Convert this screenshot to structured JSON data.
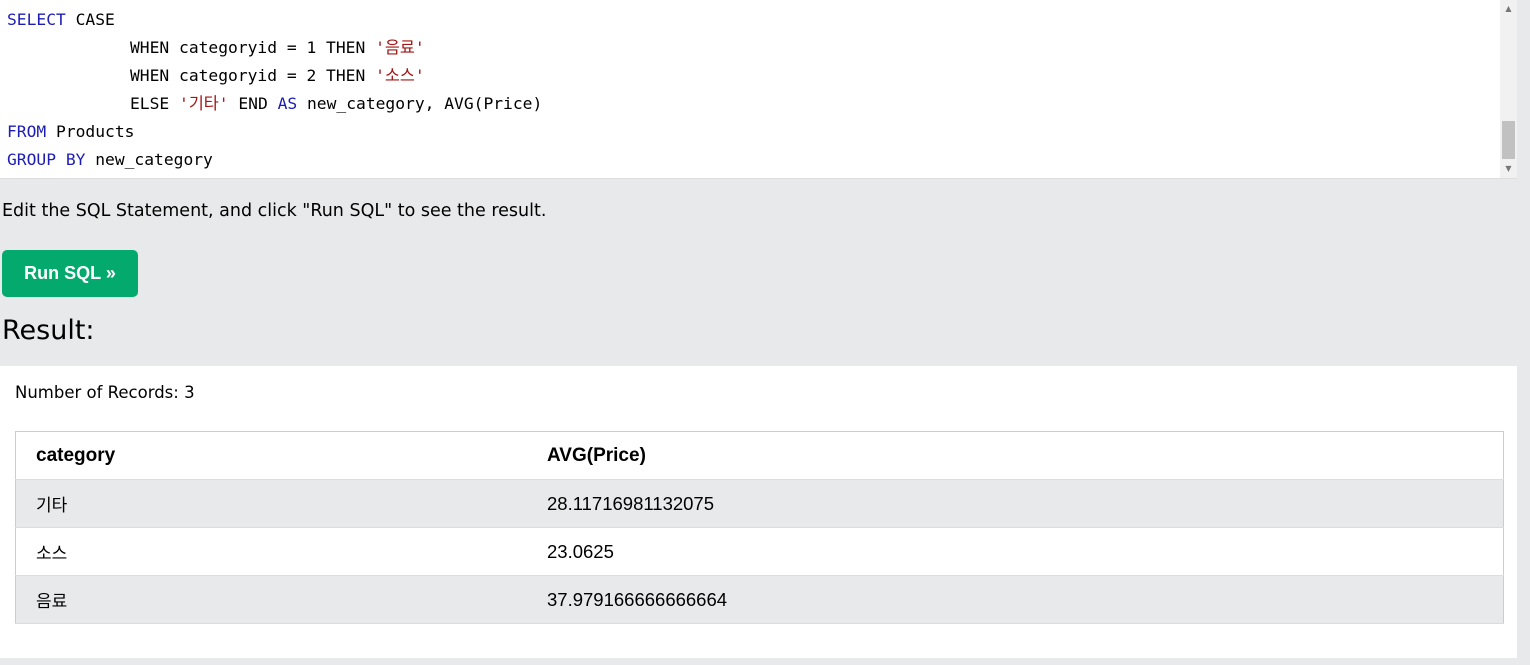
{
  "editor": {
    "lines": [
      {
        "parts": [
          {
            "t": "SELECT",
            "c": "kw"
          },
          {
            "t": " CASE",
            "c": ""
          }
        ]
      },
      {
        "indent": true,
        "parts": [
          {
            "t": "WHEN categoryid = 1 THEN ",
            "c": ""
          },
          {
            "t": "'음료'",
            "c": "str"
          }
        ]
      },
      {
        "indent": true,
        "parts": [
          {
            "t": "WHEN categoryid = 2 THEN ",
            "c": ""
          },
          {
            "t": "'소스'",
            "c": "str"
          }
        ]
      },
      {
        "indent": true,
        "parts": [
          {
            "t": "ELSE ",
            "c": ""
          },
          {
            "t": "'기타'",
            "c": "str"
          },
          {
            "t": " END ",
            "c": ""
          },
          {
            "t": "AS",
            "c": "kw"
          },
          {
            "t": " new_category, AVG(Price)",
            "c": ""
          }
        ]
      },
      {
        "parts": [
          {
            "t": "FROM",
            "c": "kw"
          },
          {
            "t": " Products",
            "c": ""
          }
        ]
      },
      {
        "parts": [
          {
            "t": "GROUP BY",
            "c": "kw"
          },
          {
            "t": " new_category",
            "c": ""
          }
        ]
      }
    ]
  },
  "instruction": "Edit the SQL Statement, and click \"Run SQL\" to see the result.",
  "run_button": {
    "label": "Run SQL »"
  },
  "result": {
    "heading": "Result:",
    "records_label": "Number of Records: 3",
    "columns": [
      "category",
      "AVG(Price)"
    ],
    "rows": [
      [
        "기타",
        "28.1171698113207 5"
      ],
      [
        "소스",
        "23.0625"
      ],
      [
        "음료",
        "37.979166666666664"
      ]
    ]
  },
  "colors": {
    "keyword": "#1d1db4",
    "string": "#a31515",
    "button": "#04aa6d",
    "background": "#e7e9eb"
  }
}
